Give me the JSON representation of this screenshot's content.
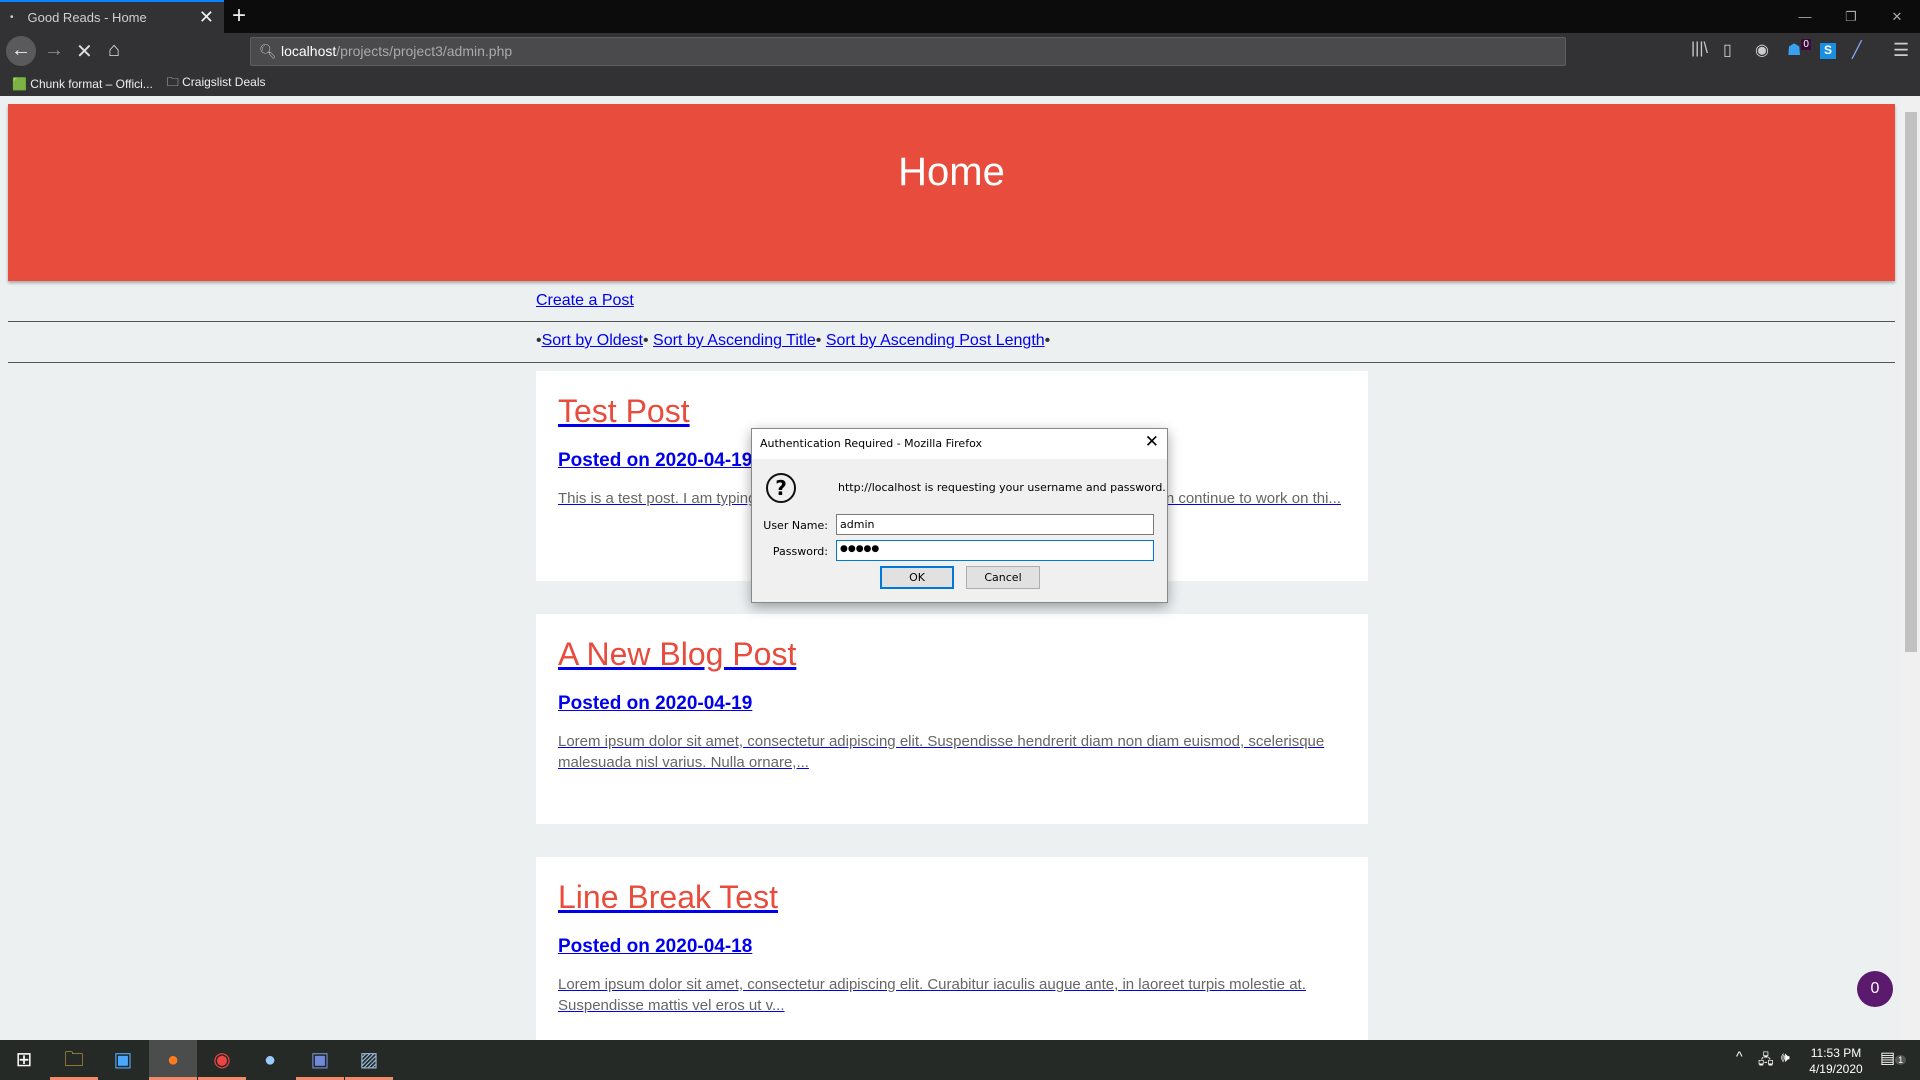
{
  "browser": {
    "tab_title": "Good Reads - Home",
    "url_host": "localhost",
    "url_path": "/projects/project3/admin.php",
    "bookmarks": [
      "Chunk format – Offici...",
      "Craigslist Deals"
    ],
    "badge_count": "0"
  },
  "page": {
    "header": "Home",
    "create_link": "Create a Post",
    "sort_links": [
      "Sort by Oldest",
      "Sort by Ascending Title",
      "Sort by Ascending Post Length"
    ],
    "posts": [
      {
        "title": "Test Post",
        "date": "Posted on 2020-04-19",
        "excerpt": "This is a test post. I am typing a bunch of text so that I am typing a bunch of text so that I can continue to work on thi..."
      },
      {
        "title": "A New Blog Post",
        "date": "Posted on 2020-04-19",
        "excerpt": "Lorem ipsum dolor sit amet, consectetur adipiscing elit. Suspendisse hendrerit diam non diam euismod, scelerisque malesuada nisl varius. Nulla ornare,..."
      },
      {
        "title": "Line Break Test",
        "date": "Posted on 2020-04-18",
        "excerpt": "Lorem ipsum dolor sit amet, consectetur adipiscing elit. Curabitur iaculis augue ante, in laoreet turpis molestie at. Suspendisse mattis vel eros ut v..."
      }
    ],
    "bubble_count": "0"
  },
  "dialog": {
    "title": "Authentication Required - Mozilla Firefox",
    "message": "http://localhost is requesting your username and password.",
    "username_label": "User Name:",
    "username": "admin",
    "password_label": "Password:",
    "password_mask": "●●●●●",
    "ok": "OK",
    "cancel": "Cancel"
  },
  "taskbar": {
    "time": "11:53 PM",
    "date": "4/19/2020",
    "notifications": "1"
  }
}
